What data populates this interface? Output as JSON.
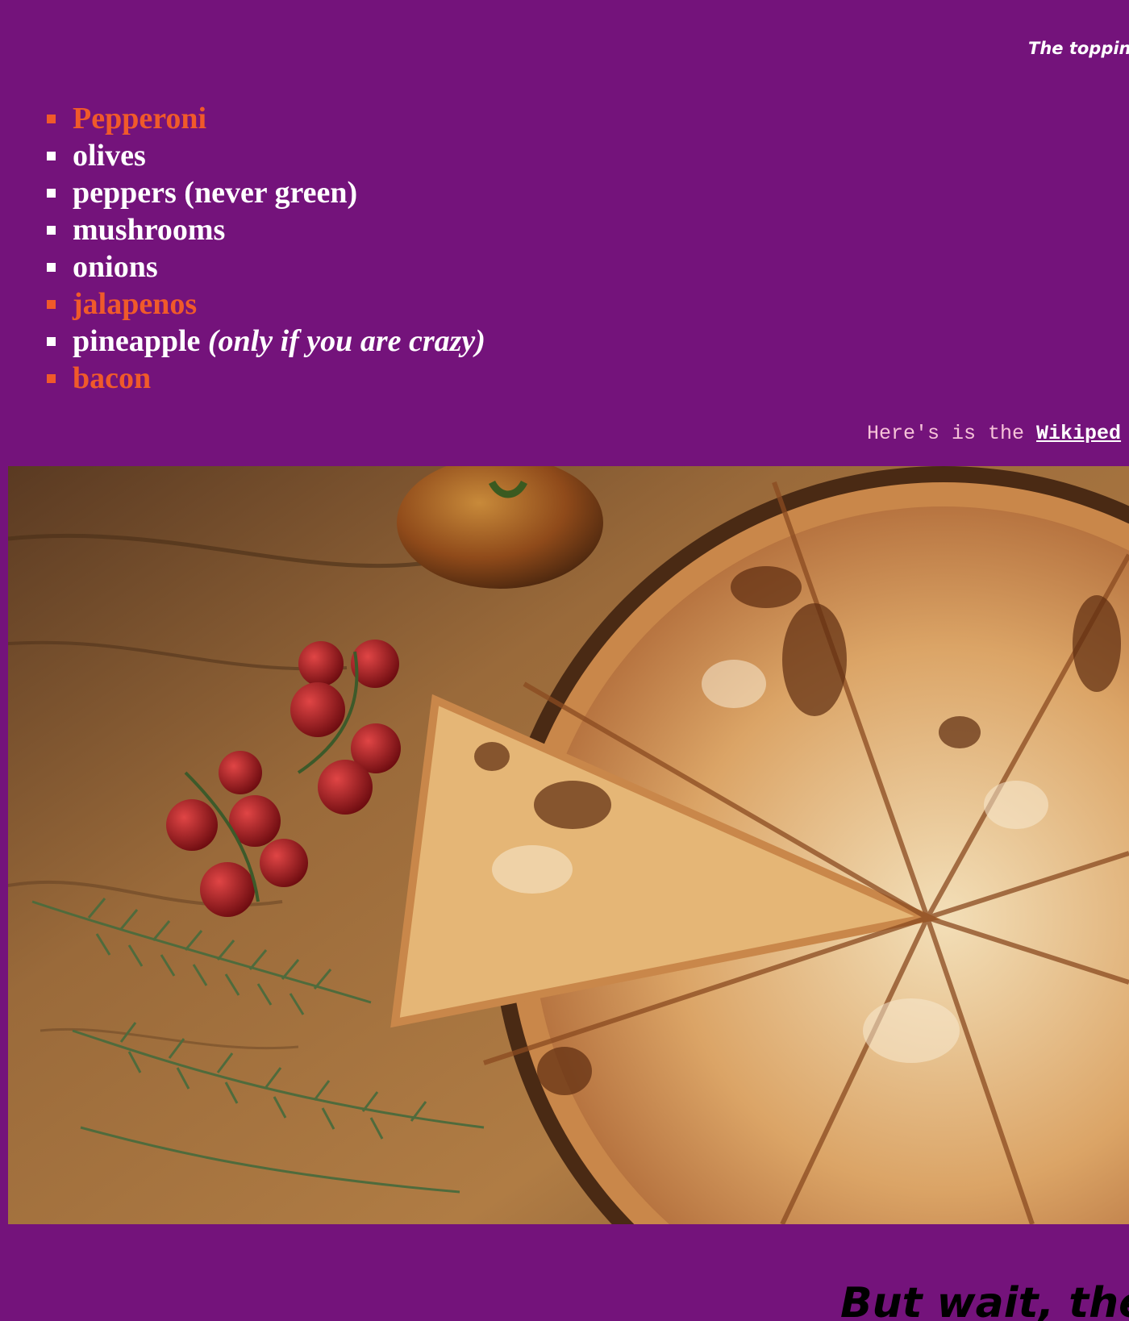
{
  "intro": {
    "text": "The toppin"
  },
  "toppings": [
    {
      "label": "Pepperoni",
      "accent": true
    },
    {
      "label": "olives",
      "accent": false
    },
    {
      "label": "peppers (never green)",
      "accent": false
    },
    {
      "label": "mushrooms",
      "accent": false
    },
    {
      "label": "onions",
      "accent": false
    },
    {
      "label": "jalapenos",
      "accent": true
    },
    {
      "label": "pineapple",
      "note": "(only if you are crazy)",
      "accent": false
    },
    {
      "label": "bacon",
      "accent": true
    }
  ],
  "wiki": {
    "prefix": "Here's is the ",
    "link_text": "Wikiped"
  },
  "footer": {
    "heading": "But wait, the"
  },
  "colors": {
    "background": "#74137b",
    "accent": "#f05a2a",
    "text": "#ffffff",
    "mono_text": "#f6c2d8"
  }
}
